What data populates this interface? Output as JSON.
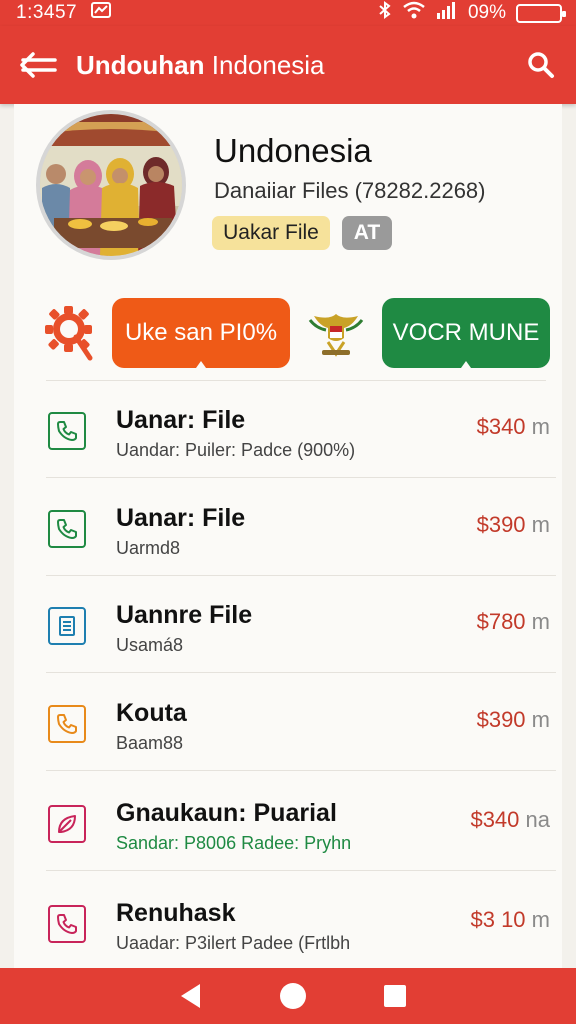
{
  "status_bar": {
    "time": "1:3457",
    "battery": "09%",
    "icons": [
      "notification-icon",
      "bluetooth-icon",
      "wifi-icon",
      "signal-icon",
      "battery-icon"
    ]
  },
  "app_bar": {
    "title_bold": "Undouhan",
    "title_rest": " Indonesia"
  },
  "profile": {
    "name": "Undonesia",
    "files": "Danaiiar Files (78282.2268)",
    "badge_primary": "Uakar File",
    "badge_secondary": "AT"
  },
  "actions": {
    "promo_orange": "Uke san PI0%",
    "promo_green": "VOCR MUNE"
  },
  "items": [
    {
      "title": "Uanar: File",
      "subtitle": "Uandar: Puiler: Padce (900%)",
      "price": "$340",
      "unit": " m",
      "icon": "phone-icon",
      "color": "#1f8a43"
    },
    {
      "title": "Uanar: File",
      "subtitle": "Uarmd8",
      "price": "$390",
      "unit": " m",
      "icon": "phone-icon",
      "color": "#1f8a43"
    },
    {
      "title": "Uannre File",
      "subtitle": "Usamá8",
      "price": "$780",
      "unit": " m",
      "icon": "document-icon",
      "color": "#1e7fb0"
    },
    {
      "title": "Kouta",
      "subtitle": "Baam88",
      "price": "$390",
      "unit": " m",
      "icon": "phone-icon",
      "color": "#e88a1a"
    },
    {
      "title": "Gnaukaun: Puarial",
      "subtitle": "Sandar: P8006 Radee: Pryhn",
      "price": "$340",
      "unit": " na",
      "icon": "leaf-icon",
      "color": "#c8245a"
    },
    {
      "title": "Renuhask",
      "subtitle": "Uaadar: P3ilert Padee (Frtlbh",
      "price": "$3 10",
      "unit": " m",
      "icon": "phone-icon",
      "color": "#c8245a"
    }
  ],
  "colors": {
    "primary": "#e23e34",
    "orange": "#ef5a17",
    "green": "#1f8a43",
    "price": "#c23a2a"
  }
}
